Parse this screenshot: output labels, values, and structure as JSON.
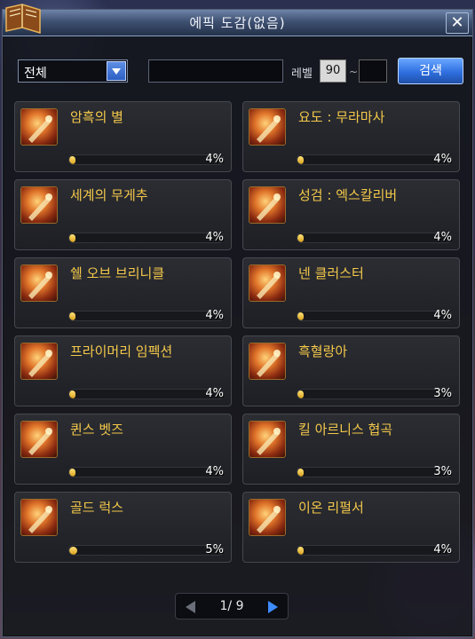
{
  "window": {
    "title": "에픽 도감(없음)",
    "close_glyph": "✕"
  },
  "filter": {
    "category_selected": "전체",
    "name_value": "",
    "level_label": "레벨",
    "level_min": "90",
    "level_tilde": "~",
    "level_max": "",
    "search_label": "검색"
  },
  "items": [
    {
      "name": "암흑의 별",
      "progress": 0.04,
      "progress_text": "4%",
      "icon": "weapon-icon"
    },
    {
      "name": "요도 : 무라마사",
      "progress": 0.04,
      "progress_text": "4%",
      "icon": "weapon-icon"
    },
    {
      "name": "세계의 무게추",
      "progress": 0.04,
      "progress_text": "4%",
      "icon": "weapon-icon"
    },
    {
      "name": "성검 : 엑스칼리버",
      "progress": 0.04,
      "progress_text": "4%",
      "icon": "weapon-icon"
    },
    {
      "name": "쉘 오브 브리니클",
      "progress": 0.04,
      "progress_text": "4%",
      "icon": "weapon-icon"
    },
    {
      "name": "넨 클러스터",
      "progress": 0.04,
      "progress_text": "4%",
      "icon": "weapon-icon"
    },
    {
      "name": "프라이머리 임펙션",
      "progress": 0.04,
      "progress_text": "4%",
      "icon": "weapon-icon"
    },
    {
      "name": "흑혈랑아",
      "progress": 0.03,
      "progress_text": "3%",
      "icon": "weapon-icon"
    },
    {
      "name": "퀸스 벳즈",
      "progress": 0.04,
      "progress_text": "4%",
      "icon": "weapon-icon"
    },
    {
      "name": "킬 아르니스 협곡",
      "progress": 0.03,
      "progress_text": "3%",
      "icon": "weapon-icon"
    },
    {
      "name": "골드 럭스",
      "progress": 0.05,
      "progress_text": "5%",
      "icon": "weapon-icon"
    },
    {
      "name": "이온 리펄서",
      "progress": 0.04,
      "progress_text": "4%",
      "icon": "weapon-icon"
    }
  ],
  "pager": {
    "text": "1/ 9"
  },
  "colors": {
    "item_name": "#f4c84a",
    "progress": "#e0a81c",
    "search_button": "#2f6fe0"
  }
}
